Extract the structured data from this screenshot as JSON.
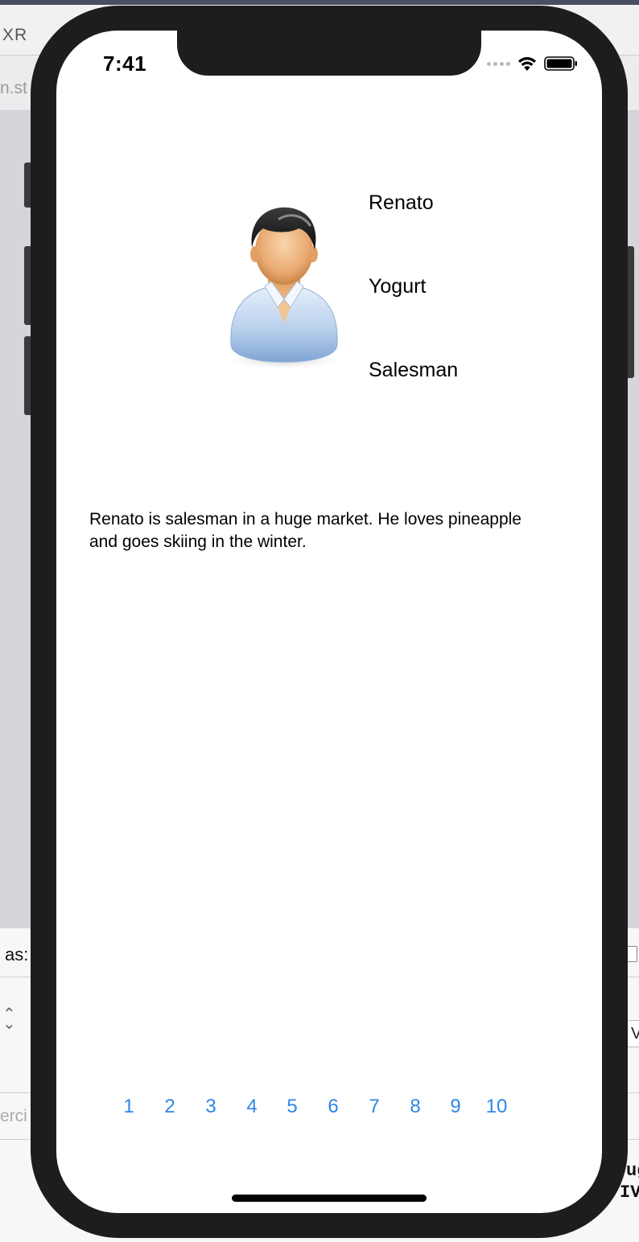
{
  "xcode": {
    "device_label": "XR",
    "file_fragment": "n.st",
    "inspector_fragment": "as:",
    "stepper_glyph": "⌃⌄",
    "placeholder_fragment": "erci",
    "select_fragment": "V",
    "code_fragment_1": "ug",
    "code_fragment_2": "IV"
  },
  "status_bar": {
    "time": "7:41",
    "signal_icon": "signal-dots-icon",
    "wifi_icon": "wifi-icon",
    "battery_icon": "battery-icon"
  },
  "profile": {
    "avatar_icon": "user-avatar-icon",
    "name": "Renato",
    "favorite_food": "Yogurt",
    "job": "Salesman",
    "description": "Renato is salesman in a huge market. He loves pineapple and goes skiing in the winter."
  },
  "pager": {
    "pages": [
      "1",
      "2",
      "3",
      "4",
      "5",
      "6",
      "7",
      "8",
      "9",
      "10"
    ],
    "color": "#2f86e6"
  },
  "colors": {
    "device_frame": "#1d1d1f",
    "screen_background": "#ffffff",
    "link_blue": "#2f86e6"
  }
}
